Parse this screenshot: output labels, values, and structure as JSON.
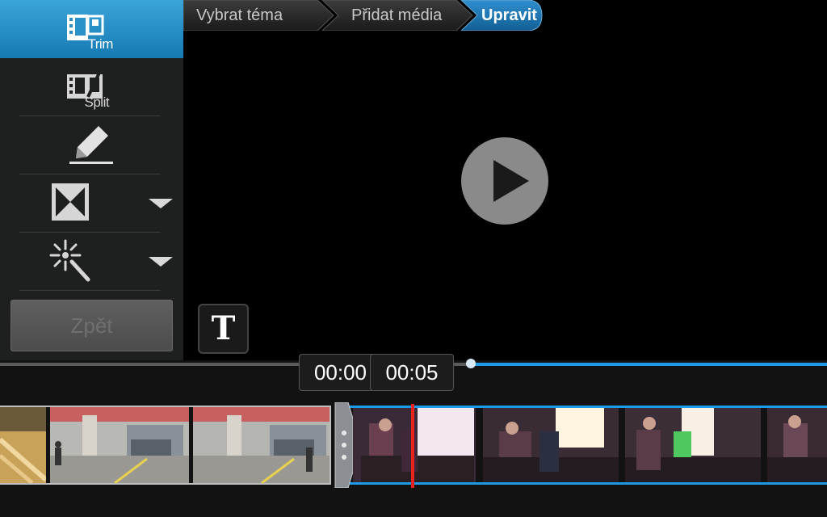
{
  "toolbar": {
    "trim_label": "Trim",
    "split_label": "Split",
    "undo_label": "Zpět",
    "icons": [
      "trim-icon",
      "split-icon",
      "pencil-icon",
      "transition-icon",
      "effects-wand-icon"
    ]
  },
  "breadcrumb": {
    "steps": [
      {
        "label": "Vybrat téma",
        "active": false
      },
      {
        "label": "Přidat média",
        "active": false
      },
      {
        "label": "Upravit",
        "active": true
      }
    ]
  },
  "preview": {
    "text_button_label": "T"
  },
  "timeline": {
    "start_time": "00:00",
    "current_time": "00:05",
    "progress_fraction": 0.57
  },
  "colors": {
    "accent": "#1e9be8",
    "active_tool": "#2a90c8",
    "playhead": "#e8231e",
    "panel": "#1e1f1f"
  }
}
